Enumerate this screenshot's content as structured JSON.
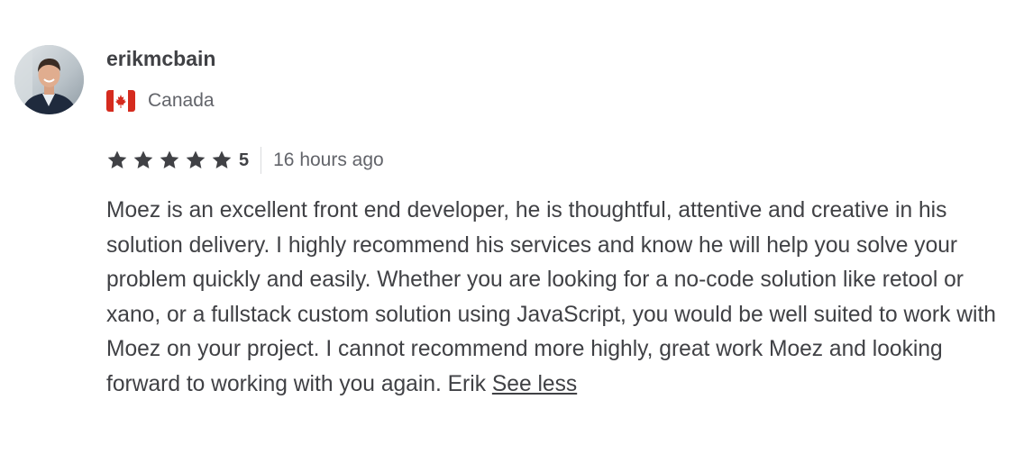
{
  "reviewer": {
    "username": "erikmcbain",
    "country": "Canada",
    "avatar_icon": "avatar-photo",
    "flag_icon": "canada-flag-icon"
  },
  "rating": {
    "stars": 5,
    "value": "5",
    "time_ago": "16 hours ago"
  },
  "review": {
    "text": "Moez is an excellent front end developer, he is thoughtful, attentive and creative in his solution delivery. I highly recommend his services and know he will help you solve your problem quickly and easily. Whether you are looking for a no-code solution like retool or xano, or a fullstack custom solution using JavaScript, you would be well suited to work with Moez on your project. I cannot recommend more highly, great work Moez and looking forward to working with you again. Erik",
    "toggle_label": "See less"
  },
  "colors": {
    "text": "#404145",
    "muted": "#62646a",
    "flag_red": "#d52b1e",
    "divider": "#dadbdd"
  }
}
